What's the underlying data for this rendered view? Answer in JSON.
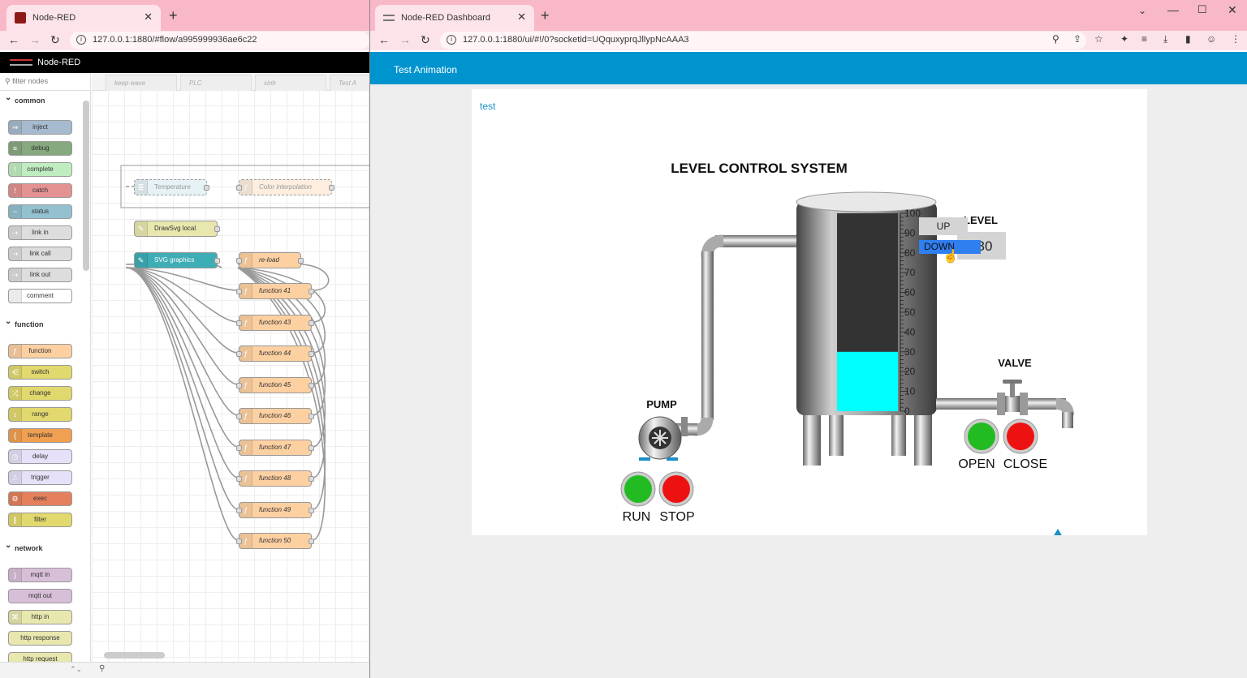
{
  "left_browser": {
    "tab_title": "Node-RED",
    "url": "127.0.0.1:1880/#flow/a995999936ae6c22",
    "app_name": "Node-RED",
    "filter_placeholder": "filter nodes",
    "categories": {
      "common": "common",
      "function": "function",
      "network": "network"
    },
    "palette_common": [
      "inject",
      "debug",
      "complete",
      "catch",
      "status",
      "link in",
      "link call",
      "link out",
      "comment"
    ],
    "palette_function": [
      "function",
      "switch",
      "change",
      "range",
      "template",
      "delay",
      "trigger",
      "exec",
      "filter"
    ],
    "palette_network": [
      "mqtt in",
      "mqtt out",
      "http in",
      "http response",
      "http request"
    ],
    "ws_tabs": [
      "keep wave",
      "PLC",
      "sinh",
      "Test A"
    ],
    "flow_nodes": {
      "temperature": "Temperature",
      "color_interp": "Color interpolation",
      "drawsvg": "DrawSvg local",
      "svg_graphics": "SVG graphics",
      "reload": "re-load",
      "functions": [
        "function 41",
        "function 43",
        "function 44",
        "function 45",
        "function 46",
        "function 47",
        "function 48",
        "function 49",
        "function 50"
      ]
    }
  },
  "right_browser": {
    "tab_title": "Node-RED Dashboard",
    "url": "127.0.0.1:1880/ui/#!/0?socketid=UQquxyprqJllypNcAAA3",
    "dashboard_title": "Test Animation",
    "group_title": "test",
    "scada": {
      "title": "LEVEL CONTROL SYSTEM",
      "level_label": "LEVEL",
      "level_value": "30",
      "level_percent": 30,
      "up_button": "UP",
      "down_button": "DOWN",
      "scale_ticks": [
        "100",
        "90",
        "80",
        "70",
        "60",
        "50",
        "40",
        "30",
        "20",
        "10",
        "0"
      ],
      "pump_label": "PUMP",
      "valve_label": "VALVE",
      "run_label": "RUN",
      "stop_label": "STOP",
      "open_label": "OPEN",
      "close_label": "CLOSE",
      "colors": {
        "liquid": "#00ffff",
        "tank_empty": "#333333",
        "green_btn": "#22bb22",
        "red_btn": "#ee1111",
        "down_highlight": "#2f7ff0"
      }
    }
  },
  "colors": {
    "tabbar": "#f8b8c8",
    "dashboard_header": "#0094ce"
  }
}
